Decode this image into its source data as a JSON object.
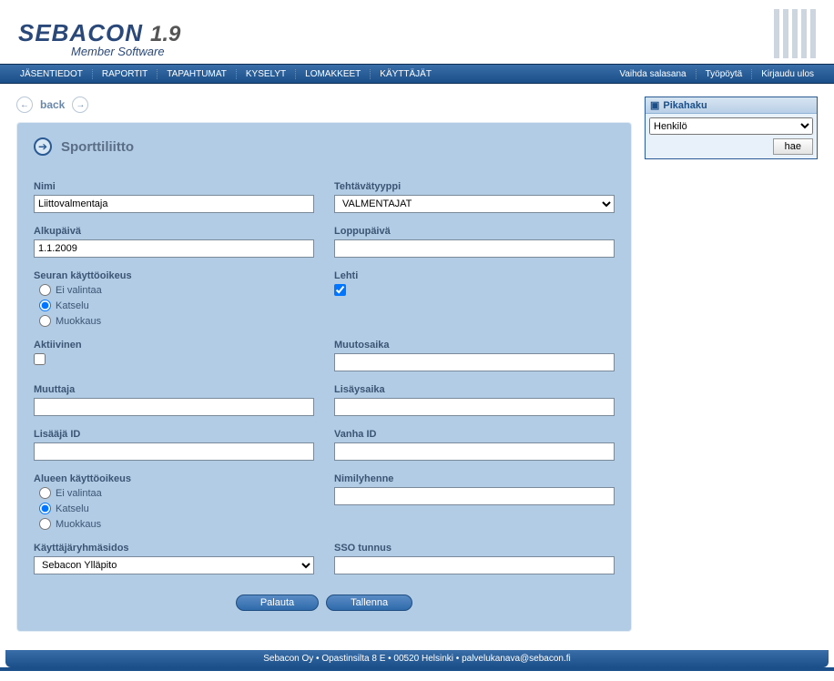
{
  "app": {
    "name": "SEBACON",
    "version": "1.9",
    "subtitle": "Member Software"
  },
  "nav": {
    "left": [
      "JÄSENTIEDOT",
      "RAPORTIT",
      "TAPAHTUMAT",
      "KYSELYT",
      "LOMAKKEET",
      "KÄYTTÄJÄT"
    ],
    "right": [
      "Vaihda salasana",
      "Työpöytä",
      "Kirjaudu ulos"
    ]
  },
  "back_label": "back",
  "page_title": "Sporttiliitto",
  "fields": {
    "nimi": {
      "label": "Nimi",
      "value": "Liittovalmentaja"
    },
    "tehtavatyyppi": {
      "label": "Tehtävätyyppi",
      "value": "VALMENTAJAT"
    },
    "alkupaiva": {
      "label": "Alkupäivä",
      "value": "1.1.2009"
    },
    "loppupaiva": {
      "label": "Loppupäivä",
      "value": ""
    },
    "seuran": {
      "label": "Seuran käyttöoikeus",
      "options": [
        "Ei valintaa",
        "Katselu",
        "Muokkaus"
      ],
      "selected": 1
    },
    "lehti": {
      "label": "Lehti",
      "checked": true
    },
    "aktiivinen": {
      "label": "Aktiivinen",
      "checked": false
    },
    "muutosaika": {
      "label": "Muutosaika",
      "value": ""
    },
    "muuttaja": {
      "label": "Muuttaja",
      "value": ""
    },
    "lisaysaika": {
      "label": "Lisäysaika",
      "value": ""
    },
    "lisaaja_id": {
      "label": "Lisääjä ID",
      "value": ""
    },
    "vanha_id": {
      "label": "Vanha ID",
      "value": ""
    },
    "alueen": {
      "label": "Alueen käyttöoikeus",
      "options": [
        "Ei valintaa",
        "Katselu",
        "Muokkaus"
      ],
      "selected": 1
    },
    "nimilyhenne": {
      "label": "Nimilyhenne",
      "value": ""
    },
    "kayttajaryhma": {
      "label": "Käyttäjäryhmäsidos",
      "value": "Sebacon Ylläpito"
    },
    "sso": {
      "label": "SSO tunnus",
      "value": ""
    }
  },
  "buttons": {
    "reset": "Palauta",
    "save": "Tallenna"
  },
  "quicksearch": {
    "title": "Pikahaku",
    "option": "Henkilö",
    "button": "hae"
  },
  "footer": "Sebacon Oy • Opastinsilta 8 E • 00520 Helsinki • palvelukanava@sebacon.fi"
}
